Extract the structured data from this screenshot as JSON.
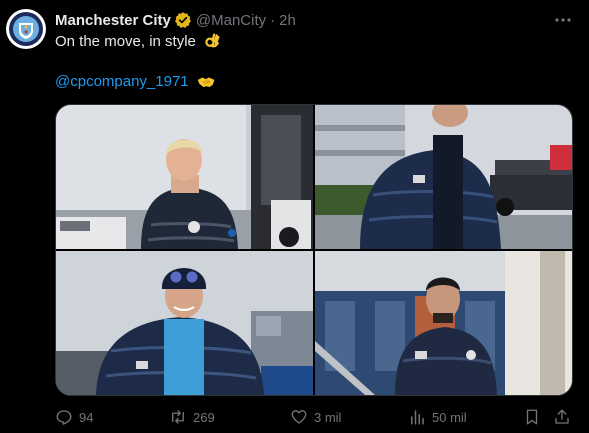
{
  "post": {
    "display_name": "Manchester City",
    "handle": "@ManCity",
    "separator": "·",
    "time": "2h",
    "text": "On the move, in style",
    "mention": "@cpcompany_1971",
    "avatar_icon": "man-city-crest-icon",
    "verified_icon": "verified-badge-icon",
    "more_icon": "more-horizontal-icon"
  },
  "media": {
    "photos": [
      {
        "name": "photo-1"
      },
      {
        "name": "photo-2"
      },
      {
        "name": "photo-3"
      },
      {
        "name": "photo-4"
      }
    ]
  },
  "actions": {
    "replies": "94",
    "retweets": "269",
    "likes": "3 mil",
    "views": "50 mil",
    "icons": [
      "reply-icon",
      "retweet-icon",
      "like-icon",
      "views-icon",
      "bookmark-icon",
      "share-icon"
    ]
  },
  "colors": {
    "background": "#000000",
    "text": "#e7e9ea",
    "muted": "#71767b",
    "link": "#1d9bf0",
    "verified": "#e2b719",
    "border": "#2f3336"
  }
}
